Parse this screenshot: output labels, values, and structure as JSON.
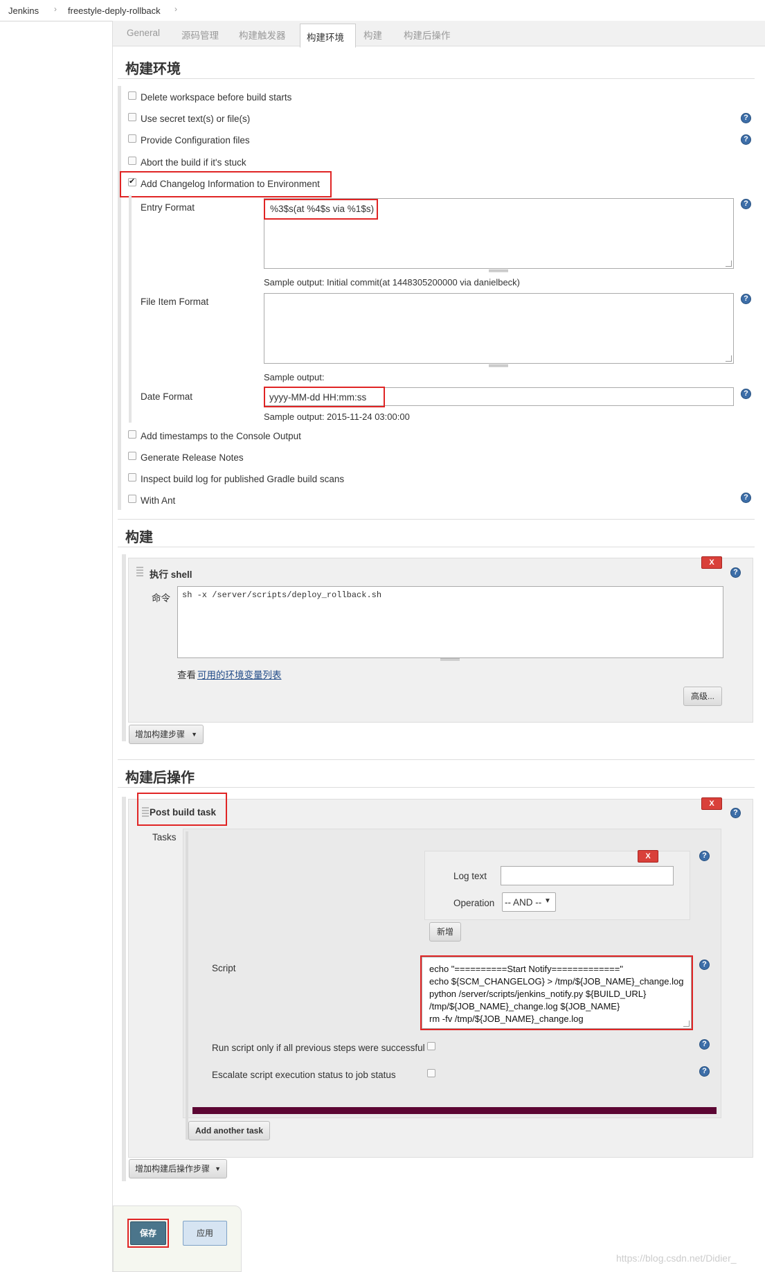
{
  "breadcrumb": {
    "items": [
      "Jenkins",
      "freestyle-deply-rollback"
    ]
  },
  "tabs": [
    "General",
    "源码管理",
    "构建触发器",
    "构建环境",
    "构建",
    "构建后操作"
  ],
  "build_env": {
    "title": "构建环境",
    "options": [
      {
        "label": "Delete workspace before build starts",
        "checked": false
      },
      {
        "label": "Use secret text(s) or file(s)",
        "checked": false
      },
      {
        "label": "Provide Configuration files",
        "checked": false
      },
      {
        "label": "Abort the build if it's stuck",
        "checked": false
      },
      {
        "label": "Add Changelog Information to Environment",
        "checked": true
      }
    ],
    "entry_format_label": "Entry Format",
    "entry_format_value": "%3$s(at %4$s via %1$s)",
    "entry_sample": "Sample output:  Initial commit(at 1448305200000 via danielbeck)",
    "file_item_label": "File Item Format",
    "file_item_value": "",
    "file_item_sample": "Sample output:",
    "date_format_label": "Date Format",
    "date_format_value": "yyyy-MM-dd HH:mm:ss",
    "date_sample": "Sample output:  2015-11-24 03:00:00",
    "more_options": [
      {
        "label": "Add timestamps to the Console Output",
        "checked": false
      },
      {
        "label": "Generate Release Notes",
        "checked": false
      },
      {
        "label": "Inspect build log for published Gradle build scans",
        "checked": false
      },
      {
        "label": "With Ant",
        "checked": false
      }
    ]
  },
  "build": {
    "title": "构建",
    "step_title": "执行 shell",
    "command_label": "命令",
    "command_value": "sh -x /server/scripts/deploy_rollback.sh",
    "env_hint_prefix": "查看",
    "env_hint_link": "可用的环境变量列表",
    "advanced_label": "高级...",
    "add_step_label": "增加构建步骤",
    "delete_label": "X"
  },
  "post_build": {
    "title": "构建后操作",
    "step_title": "Post build task",
    "tasks_label": "Tasks",
    "log_text_label": "Log text",
    "log_text_value": "",
    "operation_label": "Operation",
    "operation_value": "-- AND --",
    "add_label": "新增",
    "script_label": "Script",
    "script_lines": [
      "echo \"==========Start Notify=============\"",
      "echo ${SCM_CHANGELOG} > /tmp/${JOB_NAME}_change.log",
      "python /server/scripts/jenkins_notify.py ${BUILD_URL}",
      "/tmp/${JOB_NAME}_change.log ${JOB_NAME}",
      "rm -fv /tmp/${JOB_NAME}_change.log"
    ],
    "run_only_label": "Run script only if all previous steps were successful",
    "escalate_label": "Escalate script execution status to job status",
    "add_task_label": "Add another task",
    "add_post_step_label": "增加构建后操作步骤",
    "delete_label": "X"
  },
  "footer": {
    "save_label": "保存",
    "apply_label": "应用"
  },
  "watermark": "https://blog.csdn.net/Didier_",
  "colors": {
    "accent": "#3d6ea8",
    "delete": "#d9403a",
    "highlight": "#e02424",
    "save": "#4b758b",
    "divider": "#5c0633"
  }
}
